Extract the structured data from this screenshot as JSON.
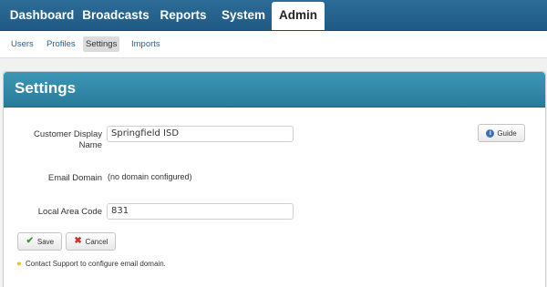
{
  "nav": {
    "tabs": [
      {
        "label": "Dashboard"
      },
      {
        "label": "Broadcasts"
      },
      {
        "label": "Reports"
      },
      {
        "label": "System"
      },
      {
        "label": "Admin"
      }
    ],
    "active": "Admin"
  },
  "subnav": {
    "items": [
      {
        "label": "Users"
      },
      {
        "label": "Profiles"
      },
      {
        "label": "Settings"
      },
      {
        "label": "Imports"
      }
    ],
    "active": "Settings"
  },
  "panel": {
    "title": "Settings",
    "guide_label": "Guide",
    "fields": {
      "customer_display_name": {
        "label": "Customer Display Name",
        "value": "Springfield ISD"
      },
      "email_domain": {
        "label": "Email Domain",
        "value": "(no domain configured)"
      },
      "local_area_code": {
        "label": "Local Area Code",
        "value": "831"
      }
    },
    "save_label": "Save",
    "cancel_label": "Cancel",
    "help_text": "Contact Support to configure email domain."
  },
  "colors": {
    "nav_bg": "#2d6c98",
    "panel_header": "#3c96b5",
    "save_icon": "#3a9a2a",
    "cancel_icon": "#d0302a",
    "guide_icon": "#3a6fb5"
  }
}
